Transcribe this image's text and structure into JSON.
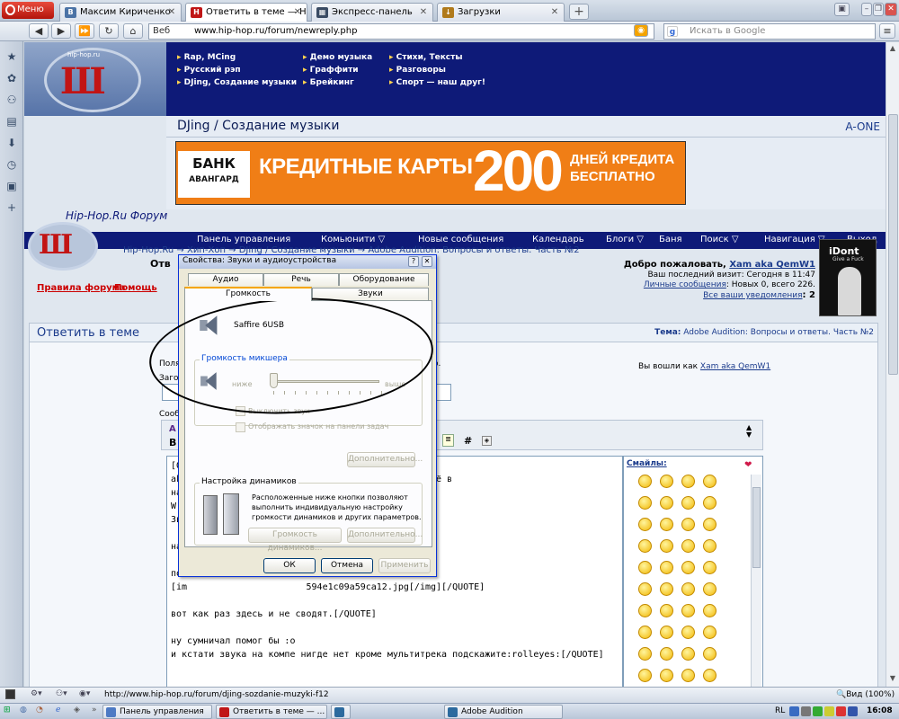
{
  "browser": {
    "menu_label": "Меню",
    "tabs": [
      {
        "label": "Максим Кириченко",
        "icon": "B",
        "color": "#4b73a6"
      },
      {
        "label": "Ответить в теме — Hip...",
        "icon": "H",
        "color": "#c01616"
      },
      {
        "label": "Экспресс-панель",
        "icon": "▦",
        "color": "#3a4b63"
      },
      {
        "label": "Загрузки",
        "icon": "↓",
        "color": "#b07a1b"
      }
    ],
    "url_prefix": "Веб",
    "url": "www.hip-hop.ru/forum/newreply.php",
    "search_placeholder": "Искать в Google"
  },
  "site": {
    "logo_text": "hip-hop.ru",
    "logo_mark": "Ш",
    "nav_col1": [
      "Rap, MCing",
      "Русский рэп",
      "DJing, Создание музыки"
    ],
    "nav_col2": [
      "Демо музыка",
      "Граффити",
      "Брейкинг"
    ],
    "nav_col3": [
      "Стихи, Тексты",
      "Разговоры",
      "Спорт — наш друг!"
    ],
    "section_title": "DJing / Создание музыки",
    "section_right": "A-ONE",
    "banner": {
      "bank": "БАНК",
      "bank_sub": "АВАНГАРД",
      "text": "КРЕДИТНЫЕ КАРТЫ",
      "number": "200",
      "line1": "ДНЕЙ КРЕДИТА",
      "line2": "БЕСПЛАТНО"
    },
    "forum_title": "Hip-Hop.Ru Форум",
    "menu": [
      "Панель управления",
      "Комьюнити ▽",
      "Новые сообщения",
      "Календарь",
      "Блоги ▽",
      "Баня",
      "Поиск ▽",
      "Навигация ▽",
      "Выход"
    ],
    "breadcrumb": "Hip-Hop.Ru → Хип-Хоп → DJing / Создание музыки → Adobe Audition: Вопросы и ответы. Часть №2",
    "breadcrumb2": "Отв",
    "rules": "Правила форума",
    "help": "Помощь",
    "welcome": {
      "line1_prefix": "Добро пожаловать, ",
      "user": "Xam aka QemW1",
      "line2": "Ваш последний визит: Сегодня в 11:47",
      "line3_link": "Личные сообщения",
      "line3_rest": ": Новых 0, всего 226.",
      "line4_link": "Все ваши уведомления",
      "line4_rest": ": 2"
    },
    "avatar_title": "iDont",
    "avatar_sub": "Give a Fuck"
  },
  "reply": {
    "title": "Ответить в теме",
    "topic_label": "Тема:",
    "topic": "Adobe Audition: Вопросы и ответы. Часть №2",
    "logged_prefix": "Вы вошли как ",
    "logged_user": "Xam aka QemW1",
    "frag_pol": "Поля",
    "frag_zag": "Заго",
    "frag_soob": "Сооб",
    "frag_dot": "о.",
    "toolbar_hash": "#",
    "editor_lines": [
      "[QUOTE=     ;7Вагон];1073751707'][QUOTE=Xam",
      "ak                        ауд нт1 а и саффир 6 всё в",
      "на                       мультитрека переходишь в",
      "W",
      "Зв                      used:",
      "",
      "на",
      "",
      "по",
      "[im                      594e1c09a59ca12.jpg[/img][/QUOTE]",
      "",
      "вот как раз здесь и не сводят.[/QUOTE]",
      "",
      "ну сумничал помог бы :о",
      "и кстати звука на компе нигде нет кроме мультитрека подскажите:rolleyes:[/QUOTE]"
    ],
    "smilies_label": "Смайлы:"
  },
  "dialog": {
    "title": "Свойства: Звуки и аудиоустройства",
    "tabs_row1": [
      "Аудио",
      "Речь",
      "Оборудование"
    ],
    "tabs_row2": [
      "Громкость",
      "Звуки"
    ],
    "device": "Saffire 6USB",
    "mixer_group": "Громкость микшера",
    "low": "ниже",
    "high": "выше",
    "mute": "Выключить звук",
    "taskbar_icon": "Отображать значок на панели задач",
    "advanced": "Дополнительно...",
    "speakers_group": "Настройка динамиков",
    "speakers_text": "Расположенные ниже кнопки позволяют выполнить индивидуальную настройку громкости динамиков и других параметров.",
    "speaker_volume": "Громкость динамиков...",
    "advanced2": "Дополнительно...",
    "ok": "ОК",
    "cancel": "Отмена",
    "apply": "Применить",
    "slider_value": 0.0
  },
  "status": {
    "url": "http://www.hip-hop.ru/forum/djing-sozdanie-muzyki-f12",
    "zoom": "Вид (100%)"
  },
  "taskbar": {
    "items": [
      {
        "label": "Панель управления",
        "color": "#4d7ac4"
      },
      {
        "label": "Ответить в теме — ...",
        "color": "#c01616"
      },
      {
        "label": "",
        "color": "#2c6a9e"
      },
      {
        "label": "Adobe Audition",
        "color": "#2c6a9e"
      }
    ],
    "lang": "RL",
    "clock": "16:08"
  }
}
